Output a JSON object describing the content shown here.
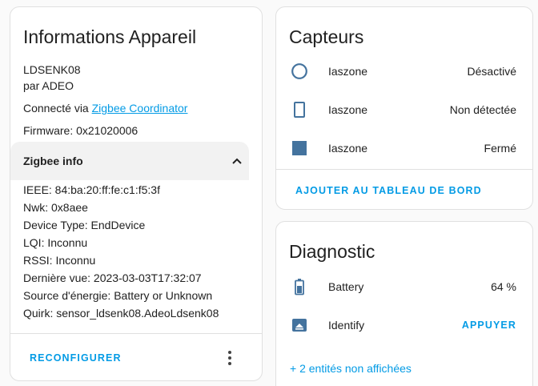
{
  "device_card": {
    "title": "Informations Appareil",
    "model": "LDSENK08",
    "manufacturer": "par ADEO",
    "connected_prefix": "Connecté via ",
    "connected_link": "Zigbee Coordinator",
    "firmware": "Firmware: 0x21020006",
    "zigbee_info_label": "Zigbee info",
    "zigbee_info": [
      "IEEE: 84:ba:20:ff:fe:c1:f5:3f",
      "Nwk: 0x8aee",
      "Device Type: EndDevice",
      "LQI: Inconnu",
      "RSSI: Inconnu",
      "Dernière vue: 2023-03-03T17:32:07",
      "Source d'énergie: Battery or Unknown",
      "Quirk: sensor_ldsenk08.AdeoLdsenk08"
    ],
    "reconfigure_label": "RECONFIGURER"
  },
  "sensors_card": {
    "title": "Capteurs",
    "items": [
      {
        "icon": "motion-off-icon",
        "name": "Iaszone",
        "state": "Désactivé"
      },
      {
        "icon": "door-closed-icon",
        "name": "Iaszone",
        "state": "Non détectée"
      },
      {
        "icon": "square-filled-icon",
        "name": "Iaszone",
        "state": "Fermé"
      }
    ],
    "add_to_dashboard_label": "AJOUTER AU TABLEAU DE BORD"
  },
  "diagnostic_card": {
    "title": "Diagnostic",
    "items": [
      {
        "icon": "battery-icon",
        "name": "Battery",
        "state": "64 %"
      },
      {
        "icon": "identify-icon",
        "name": "Identify",
        "button": "APPUYER"
      }
    ],
    "hidden_entities_label": "+ 2 entités non affichées"
  },
  "colors": {
    "accent": "#039be5",
    "icon": "#44739e",
    "text": "#212121",
    "muted": "#727272"
  }
}
